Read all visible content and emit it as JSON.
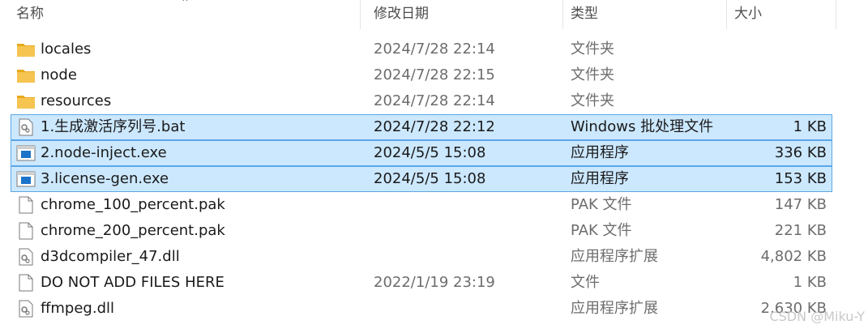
{
  "columns": {
    "name": "名称",
    "modified": "修改日期",
    "type": "类型",
    "size": "大小"
  },
  "files": [
    {
      "name": "locales",
      "date": "2024/7/28 22:14",
      "type": "文件夹",
      "size": "",
      "icon": "folder-icon",
      "selected": false
    },
    {
      "name": "node",
      "date": "2024/7/28 22:15",
      "type": "文件夹",
      "size": "",
      "icon": "folder-icon",
      "selected": false
    },
    {
      "name": "resources",
      "date": "2024/7/28 22:14",
      "type": "文件夹",
      "size": "",
      "icon": "folder-icon",
      "selected": false
    },
    {
      "name": "1.生成激活序列号.bat",
      "date": "2024/7/28 22:12",
      "type": "Windows 批处理文件",
      "size": "1 KB",
      "icon": "batch-file-icon",
      "selected": true
    },
    {
      "name": "2.node-inject.exe",
      "date": "2024/5/5 15:08",
      "type": "应用程序",
      "size": "336 KB",
      "icon": "exe-icon",
      "selected": true
    },
    {
      "name": "3.license-gen.exe",
      "date": "2024/5/5 15:08",
      "type": "应用程序",
      "size": "153 KB",
      "icon": "exe-icon",
      "selected": true
    },
    {
      "name": "chrome_100_percent.pak",
      "date": "",
      "type": "PAK 文件",
      "size": "147 KB",
      "icon": "file-icon",
      "selected": false
    },
    {
      "name": "chrome_200_percent.pak",
      "date": "",
      "type": "PAK 文件",
      "size": "221 KB",
      "icon": "file-icon",
      "selected": false
    },
    {
      "name": "d3dcompiler_47.dll",
      "date": "",
      "type": "应用程序扩展",
      "size": "4,802 KB",
      "icon": "dll-icon",
      "selected": false
    },
    {
      "name": "DO NOT ADD FILES HERE",
      "date": "2022/1/19 23:19",
      "type": "文件",
      "size": "1 KB",
      "icon": "file-icon",
      "selected": false
    },
    {
      "name": "ffmpeg.dll",
      "date": "",
      "type": "应用程序扩展",
      "size": "2,630 KB",
      "icon": "dll-icon",
      "selected": false
    }
  ],
  "watermark": "CSDN @Miku-Y",
  "colors": {
    "selection_bg": "#cce8ff",
    "selection_border": "#5aa7e6",
    "folder": "#f5c451"
  }
}
